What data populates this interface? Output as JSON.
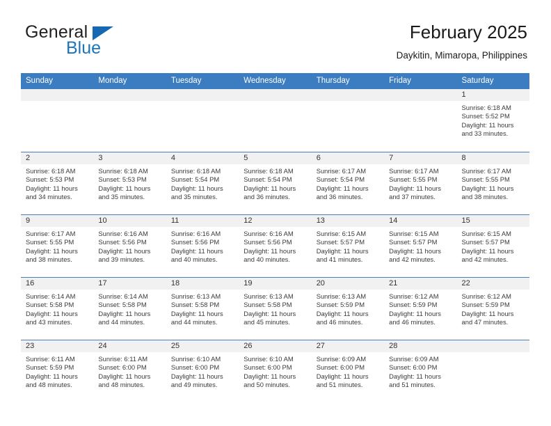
{
  "logo": {
    "word1": "General",
    "word2": "Blue",
    "triangle_color": "#1668b3",
    "word2_color": "#1b75bb"
  },
  "header": {
    "title": "February 2025",
    "subtitle": "Daykitin, Mimaropa, Philippines"
  },
  "theme": {
    "header_blue": "#3b7dc0",
    "daynum_band": "#f1f1f1",
    "row_divider": "#4a7fb5",
    "text": "#3a3a3a"
  },
  "weekdays": [
    "Sunday",
    "Monday",
    "Tuesday",
    "Wednesday",
    "Thursday",
    "Friday",
    "Saturday"
  ],
  "weeks": [
    [
      {
        "day": "",
        "sunrise": "",
        "sunset": "",
        "daylight1": "",
        "daylight2": ""
      },
      {
        "day": "",
        "sunrise": "",
        "sunset": "",
        "daylight1": "",
        "daylight2": ""
      },
      {
        "day": "",
        "sunrise": "",
        "sunset": "",
        "daylight1": "",
        "daylight2": ""
      },
      {
        "day": "",
        "sunrise": "",
        "sunset": "",
        "daylight1": "",
        "daylight2": ""
      },
      {
        "day": "",
        "sunrise": "",
        "sunset": "",
        "daylight1": "",
        "daylight2": ""
      },
      {
        "day": "",
        "sunrise": "",
        "sunset": "",
        "daylight1": "",
        "daylight2": ""
      },
      {
        "day": "1",
        "sunrise": "Sunrise: 6:18 AM",
        "sunset": "Sunset: 5:52 PM",
        "daylight1": "Daylight: 11 hours",
        "daylight2": "and 33 minutes."
      }
    ],
    [
      {
        "day": "2",
        "sunrise": "Sunrise: 6:18 AM",
        "sunset": "Sunset: 5:53 PM",
        "daylight1": "Daylight: 11 hours",
        "daylight2": "and 34 minutes."
      },
      {
        "day": "3",
        "sunrise": "Sunrise: 6:18 AM",
        "sunset": "Sunset: 5:53 PM",
        "daylight1": "Daylight: 11 hours",
        "daylight2": "and 35 minutes."
      },
      {
        "day": "4",
        "sunrise": "Sunrise: 6:18 AM",
        "sunset": "Sunset: 5:54 PM",
        "daylight1": "Daylight: 11 hours",
        "daylight2": "and 35 minutes."
      },
      {
        "day": "5",
        "sunrise": "Sunrise: 6:18 AM",
        "sunset": "Sunset: 5:54 PM",
        "daylight1": "Daylight: 11 hours",
        "daylight2": "and 36 minutes."
      },
      {
        "day": "6",
        "sunrise": "Sunrise: 6:17 AM",
        "sunset": "Sunset: 5:54 PM",
        "daylight1": "Daylight: 11 hours",
        "daylight2": "and 36 minutes."
      },
      {
        "day": "7",
        "sunrise": "Sunrise: 6:17 AM",
        "sunset": "Sunset: 5:55 PM",
        "daylight1": "Daylight: 11 hours",
        "daylight2": "and 37 minutes."
      },
      {
        "day": "8",
        "sunrise": "Sunrise: 6:17 AM",
        "sunset": "Sunset: 5:55 PM",
        "daylight1": "Daylight: 11 hours",
        "daylight2": "and 38 minutes."
      }
    ],
    [
      {
        "day": "9",
        "sunrise": "Sunrise: 6:17 AM",
        "sunset": "Sunset: 5:55 PM",
        "daylight1": "Daylight: 11 hours",
        "daylight2": "and 38 minutes."
      },
      {
        "day": "10",
        "sunrise": "Sunrise: 6:16 AM",
        "sunset": "Sunset: 5:56 PM",
        "daylight1": "Daylight: 11 hours",
        "daylight2": "and 39 minutes."
      },
      {
        "day": "11",
        "sunrise": "Sunrise: 6:16 AM",
        "sunset": "Sunset: 5:56 PM",
        "daylight1": "Daylight: 11 hours",
        "daylight2": "and 40 minutes."
      },
      {
        "day": "12",
        "sunrise": "Sunrise: 6:16 AM",
        "sunset": "Sunset: 5:56 PM",
        "daylight1": "Daylight: 11 hours",
        "daylight2": "and 40 minutes."
      },
      {
        "day": "13",
        "sunrise": "Sunrise: 6:15 AM",
        "sunset": "Sunset: 5:57 PM",
        "daylight1": "Daylight: 11 hours",
        "daylight2": "and 41 minutes."
      },
      {
        "day": "14",
        "sunrise": "Sunrise: 6:15 AM",
        "sunset": "Sunset: 5:57 PM",
        "daylight1": "Daylight: 11 hours",
        "daylight2": "and 42 minutes."
      },
      {
        "day": "15",
        "sunrise": "Sunrise: 6:15 AM",
        "sunset": "Sunset: 5:57 PM",
        "daylight1": "Daylight: 11 hours",
        "daylight2": "and 42 minutes."
      }
    ],
    [
      {
        "day": "16",
        "sunrise": "Sunrise: 6:14 AM",
        "sunset": "Sunset: 5:58 PM",
        "daylight1": "Daylight: 11 hours",
        "daylight2": "and 43 minutes."
      },
      {
        "day": "17",
        "sunrise": "Sunrise: 6:14 AM",
        "sunset": "Sunset: 5:58 PM",
        "daylight1": "Daylight: 11 hours",
        "daylight2": "and 44 minutes."
      },
      {
        "day": "18",
        "sunrise": "Sunrise: 6:13 AM",
        "sunset": "Sunset: 5:58 PM",
        "daylight1": "Daylight: 11 hours",
        "daylight2": "and 44 minutes."
      },
      {
        "day": "19",
        "sunrise": "Sunrise: 6:13 AM",
        "sunset": "Sunset: 5:58 PM",
        "daylight1": "Daylight: 11 hours",
        "daylight2": "and 45 minutes."
      },
      {
        "day": "20",
        "sunrise": "Sunrise: 6:13 AM",
        "sunset": "Sunset: 5:59 PM",
        "daylight1": "Daylight: 11 hours",
        "daylight2": "and 46 minutes."
      },
      {
        "day": "21",
        "sunrise": "Sunrise: 6:12 AM",
        "sunset": "Sunset: 5:59 PM",
        "daylight1": "Daylight: 11 hours",
        "daylight2": "and 46 minutes."
      },
      {
        "day": "22",
        "sunrise": "Sunrise: 6:12 AM",
        "sunset": "Sunset: 5:59 PM",
        "daylight1": "Daylight: 11 hours",
        "daylight2": "and 47 minutes."
      }
    ],
    [
      {
        "day": "23",
        "sunrise": "Sunrise: 6:11 AM",
        "sunset": "Sunset: 5:59 PM",
        "daylight1": "Daylight: 11 hours",
        "daylight2": "and 48 minutes."
      },
      {
        "day": "24",
        "sunrise": "Sunrise: 6:11 AM",
        "sunset": "Sunset: 6:00 PM",
        "daylight1": "Daylight: 11 hours",
        "daylight2": "and 48 minutes."
      },
      {
        "day": "25",
        "sunrise": "Sunrise: 6:10 AM",
        "sunset": "Sunset: 6:00 PM",
        "daylight1": "Daylight: 11 hours",
        "daylight2": "and 49 minutes."
      },
      {
        "day": "26",
        "sunrise": "Sunrise: 6:10 AM",
        "sunset": "Sunset: 6:00 PM",
        "daylight1": "Daylight: 11 hours",
        "daylight2": "and 50 minutes."
      },
      {
        "day": "27",
        "sunrise": "Sunrise: 6:09 AM",
        "sunset": "Sunset: 6:00 PM",
        "daylight1": "Daylight: 11 hours",
        "daylight2": "and 51 minutes."
      },
      {
        "day": "28",
        "sunrise": "Sunrise: 6:09 AM",
        "sunset": "Sunset: 6:00 PM",
        "daylight1": "Daylight: 11 hours",
        "daylight2": "and 51 minutes."
      },
      {
        "day": "",
        "sunrise": "",
        "sunset": "",
        "daylight1": "",
        "daylight2": ""
      }
    ]
  ]
}
